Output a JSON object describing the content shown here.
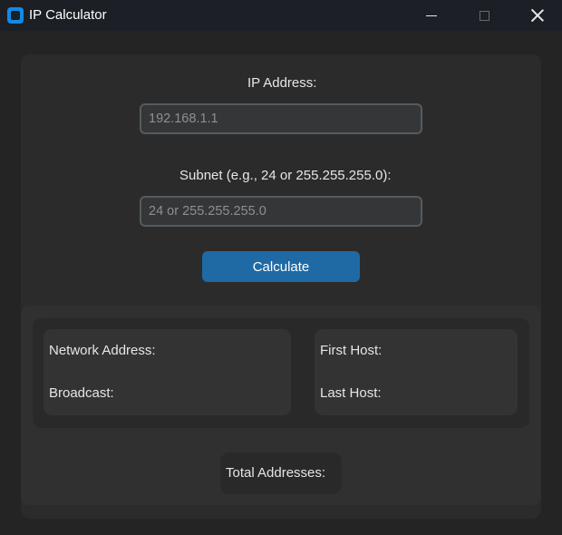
{
  "window": {
    "title": "IP Calculator"
  },
  "form": {
    "ip_label": "IP Address:",
    "ip_placeholder": "192.168.1.1",
    "ip_value": "",
    "subnet_label": "Subnet (e.g., 24 or 255.255.255.0):",
    "subnet_placeholder": "24 or 255.255.255.0",
    "subnet_value": "",
    "calculate_label": "Calculate"
  },
  "results": {
    "network_address_label": "Network Address:",
    "broadcast_label": "Broadcast:",
    "first_host_label": "First Host:",
    "last_host_label": "Last Host:",
    "total_addresses_label": "Total Addresses:"
  },
  "colors": {
    "accent": "#1f6aa5",
    "app_icon": "#0f8ce6",
    "background": "#242424"
  }
}
